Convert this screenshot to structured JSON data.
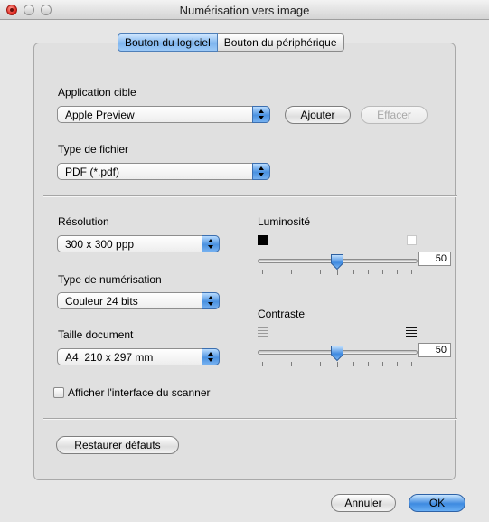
{
  "window": {
    "title": "Numérisation vers image"
  },
  "tabs": [
    {
      "label": "Bouton du logiciel",
      "active": true
    },
    {
      "label": "Bouton du périphérique",
      "active": false
    }
  ],
  "target_app": {
    "label": "Application cible",
    "selected": "Apple Preview",
    "add_button": "Ajouter",
    "delete_button": "Effacer",
    "delete_enabled": false
  },
  "file_type": {
    "label": "Type de fichier",
    "selected": "PDF (*.pdf)"
  },
  "resolution": {
    "label": "Résolution",
    "selected": "300 x 300 ppp"
  },
  "scan_type": {
    "label": "Type de numérisation",
    "selected": "Couleur 24 bits"
  },
  "doc_size": {
    "label": "Taille document",
    "selected": "A4  210 x 297 mm"
  },
  "show_scanner_ui": {
    "label": "Afficher l'interface du scanner",
    "checked": false
  },
  "brightness": {
    "label": "Luminosité",
    "value": "50",
    "min_icon": "black-square-icon",
    "max_icon": "white-square-icon"
  },
  "contrast": {
    "label": "Contraste",
    "value": "50",
    "min_icon": "low-contrast-icon",
    "max_icon": "high-contrast-icon"
  },
  "restore_button": "Restaurer défauts",
  "footer": {
    "cancel": "Annuler",
    "ok": "OK"
  },
  "colors": {
    "accent": "#4a91e0",
    "window_bg": "#e6e6e6",
    "panel_bg": "#e0e0e0"
  }
}
